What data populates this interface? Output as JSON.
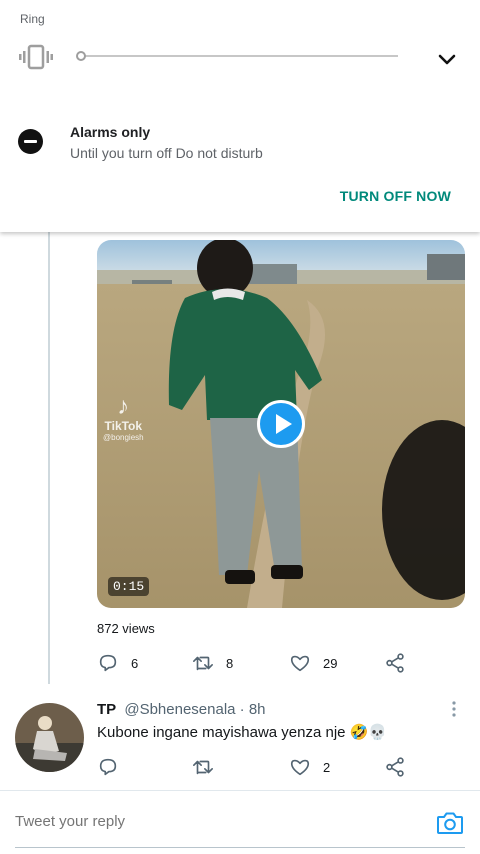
{
  "volume_panel": {
    "ring_label": "Ring",
    "ring_level": 0,
    "dnd_title": "Alarms only",
    "dnd_subtitle": "Until you turn off Do not disturb",
    "turn_off_label": "TURN OFF NOW"
  },
  "video": {
    "duration": "0:15",
    "watermark": "TikTok",
    "watermark_handle": "@bongiesh",
    "views": "872 views"
  },
  "tweet1_actions": {
    "replies": "6",
    "retweets": "8",
    "likes": "29"
  },
  "tweet2": {
    "name": "TP",
    "handle": "@Sbhenesenala",
    "time": "· 8h",
    "text": "Kubone ingane mayishawa yenza nje 🤣💀",
    "actions": {
      "replies": "",
      "retweets": "",
      "likes": "2"
    }
  },
  "reply": {
    "placeholder": "Tweet your reply"
  },
  "colors": {
    "accent_blue": "#1d9bf0",
    "dnd_teal": "#00897b"
  },
  "icons": [
    "vibrate-icon",
    "chevron-down-icon",
    "dnd-icon",
    "play-icon",
    "reply-icon",
    "retweet-icon",
    "like-icon",
    "share-icon",
    "more-icon",
    "camera-icon"
  ]
}
